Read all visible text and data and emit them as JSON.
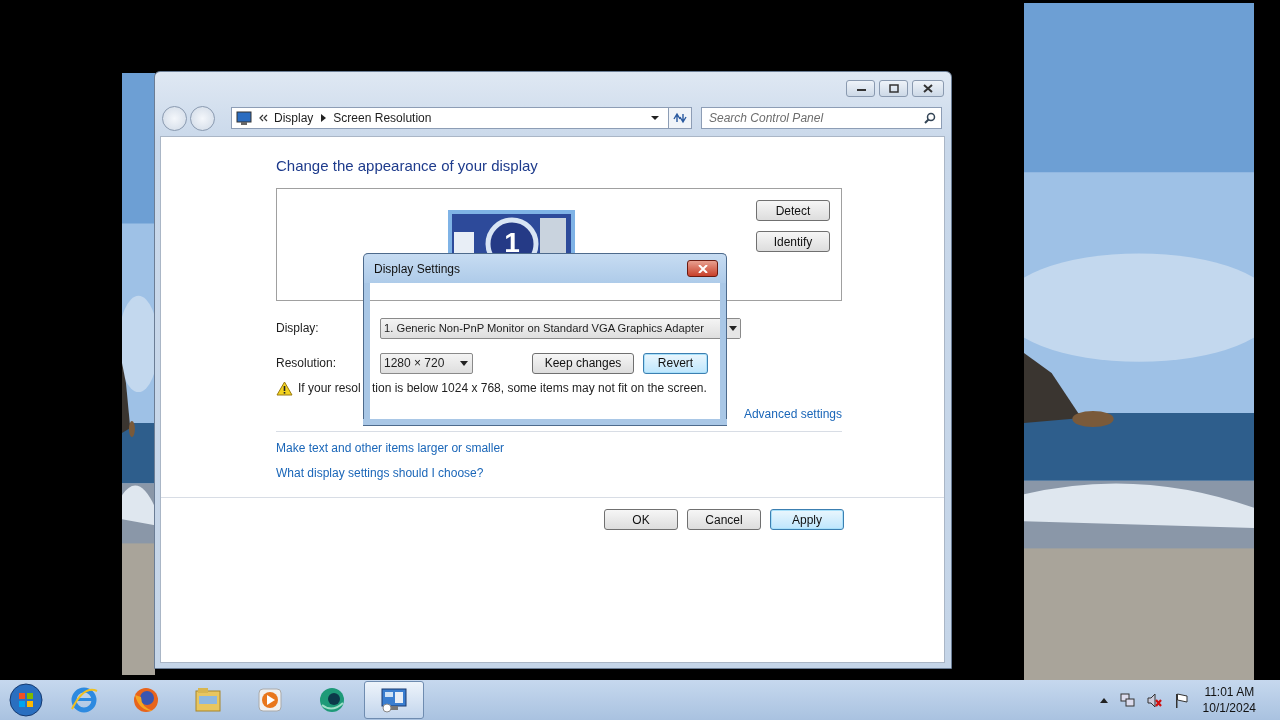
{
  "window": {
    "breadcrumb": [
      "Display",
      "Screen Resolution"
    ],
    "search": {
      "placeholder": "Search Control Panel"
    }
  },
  "heading": "Change the appearance of your display",
  "monitor": {
    "number": "1"
  },
  "side_buttons": [
    "Detect",
    "Identify"
  ],
  "display": {
    "label": "Display:",
    "value": "1. Generic Non-PnP Monitor on Standard VGA Graphics Adapter"
  },
  "resolution": {
    "label": "Resolution:",
    "value": "1280 × 720"
  },
  "confirm_buttons": [
    {
      "label": "Keep changes",
      "focused": false
    },
    {
      "label": "Revert",
      "focused": true
    }
  ],
  "warning": {
    "parts": [
      "If your resol",
      "tion is below 1024 x 768, some items may not fit on the screen."
    ]
  },
  "advanced_link": "Advanced settings",
  "links": [
    "Make text and other items larger or smaller",
    "What display settings should I choose?"
  ],
  "buttons": [
    {
      "label": "OK",
      "focused": false
    },
    {
      "label": "Cancel",
      "focused": false
    },
    {
      "label": "Apply",
      "focused": true
    }
  ],
  "dialog": {
    "title": "Display Settings"
  },
  "taskbar": {
    "apps": [
      {
        "kind": "ie",
        "selected": false
      },
      {
        "kind": "firefox",
        "selected": false
      },
      {
        "kind": "folder",
        "selected": false
      },
      {
        "kind": "media",
        "selected": false
      },
      {
        "kind": "globe",
        "selected": false
      },
      {
        "kind": "control-panel",
        "selected": true
      }
    ],
    "tray": [
      {
        "kind": "network"
      },
      {
        "kind": "sound-muted"
      },
      {
        "kind": "flag"
      }
    ],
    "time": "11:01 AM",
    "date": "10/1/2024"
  }
}
